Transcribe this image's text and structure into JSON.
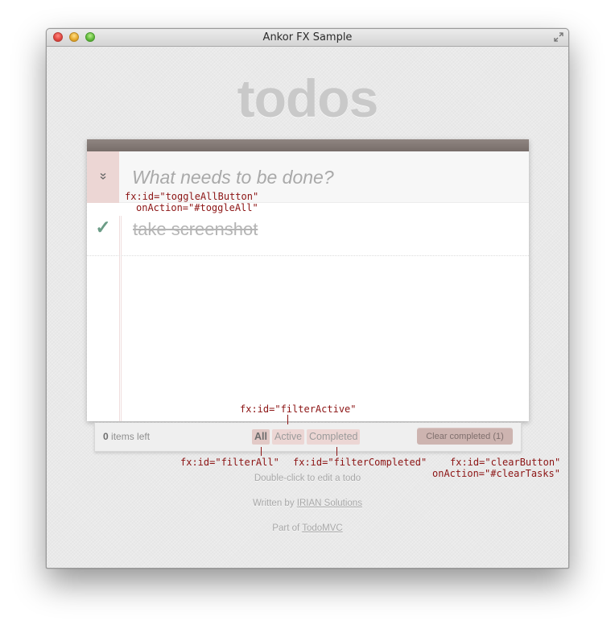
{
  "window": {
    "title": "Ankor FX Sample"
  },
  "app": {
    "title": "todos",
    "new_todo_placeholder": "What needs to be done?",
    "toggle_all_icon": "double-chevron-down",
    "todos": [
      {
        "text": "take screenshot",
        "completed": true,
        "check_glyph": "✓"
      }
    ]
  },
  "footer": {
    "items_left_count": "0",
    "items_left_label": "items left",
    "filters": [
      {
        "label": "All",
        "selected": true
      },
      {
        "label": "Active",
        "selected": false
      },
      {
        "label": "Completed",
        "selected": false
      }
    ],
    "clear_label": "Clear completed (1)"
  },
  "info": {
    "hint": "Double-click to edit a todo",
    "written_by_prefix": "Written by",
    "written_by_link": "IRIAN Solutions",
    "part_of_prefix": "Part of",
    "part_of_link": "TodoMVC"
  },
  "annotations": {
    "toggle_all_line1": "fx:id=\"toggleAllButton\"",
    "toggle_all_line2": "onAction=\"#toggleAll\"",
    "filter_active": "fx:id=\"filterActive\"",
    "filter_all": "fx:id=\"filterAll\"",
    "filter_completed": "fx:id=\"filterCompleted\"",
    "clear_line1": "fx:id=\"clearButton\"",
    "clear_line2": "onAction=\"#clearTasks\""
  },
  "colors": {
    "header_bar": "#7f7571",
    "toggle_all_bg": "#ecd6d4",
    "check": "#6b9c86",
    "annotation": "#8c1414",
    "clear_button": "#cdb4b0"
  }
}
